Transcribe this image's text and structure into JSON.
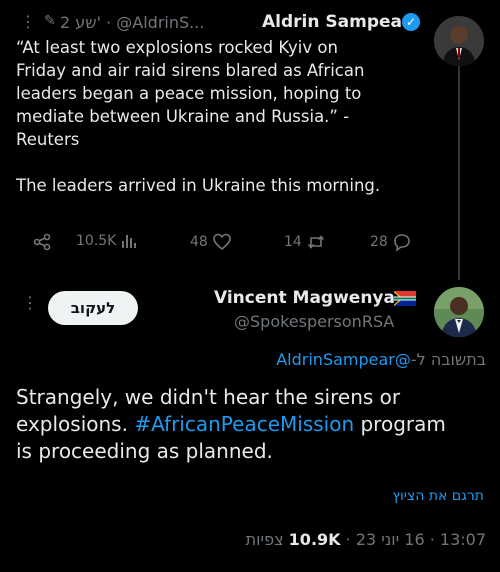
{
  "tweet1": {
    "more_label": "⋮",
    "meta": "2 שע' · @AldrinS...",
    "author_name": "Aldrin Sampear",
    "text": "“At least two explosions rocked Kyiv on\nFriday and air raid sirens blared as African\nleaders began a peace mission, hoping to\nmediate between Ukraine and Russia.” -\nReuters\n\nThe leaders arrived in Ukraine this morning.",
    "stats": {
      "views": "10.5K",
      "likes": "48",
      "reposts": "14",
      "replies": "28"
    },
    "icons": [
      "share-icon",
      "analytics-icon",
      "heart-icon",
      "repost-icon",
      "reply-icon",
      "verified-icon"
    ]
  },
  "tweet2": {
    "more_label": "⋮",
    "follow_label": "לעקוב",
    "author_name": "Vincent Magwenya",
    "handle": "@SpokespersonRSA",
    "replying_prefix": "בתשובה ל-",
    "replying_handle": "@AldrinSampear",
    "text_part1": "Strangely, we didn't hear the sirens or explosions. ",
    "hashtag": "#AfricanPeaceMission",
    "text_part2": " program is proceeding as planned.",
    "translate_label": "תרגם את הציוץ",
    "timestamp": "13:07 · 16 יוני 23 · ",
    "views_count": "10.9K",
    "views_label": " צפיות"
  },
  "colors": {
    "background": "#000000",
    "text": "#e7e9ea",
    "muted": "#71767b",
    "accent": "#1d9bf0"
  }
}
